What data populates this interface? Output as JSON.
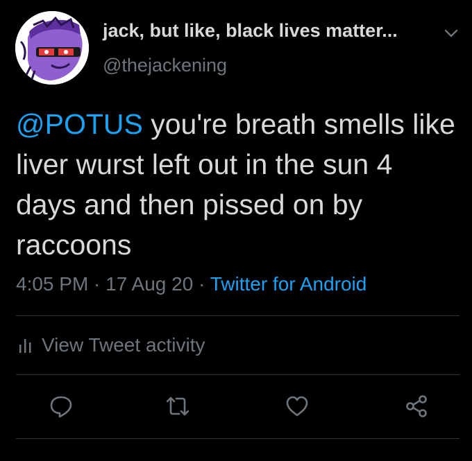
{
  "tweet": {
    "display_name": "jack, but like, black lives matter...",
    "handle": "@thejackening",
    "mention": "@POTUS",
    "body": " you're breath smells like liver wurst left out in the sun 4 days and then pissed on by raccoons",
    "time": "4:05 PM",
    "separator": " · ",
    "date": "17 Aug 20",
    "source": "Twitter for Android"
  },
  "activity": {
    "label": "View Tweet activity"
  },
  "actions": [
    "reply-icon",
    "retweet-icon",
    "like-icon",
    "share-icon"
  ],
  "colors": {
    "background": "#000000",
    "text": "#d9d9d9",
    "muted": "#6e767d",
    "accent": "#1da1f2",
    "divider": "#2f3336"
  }
}
